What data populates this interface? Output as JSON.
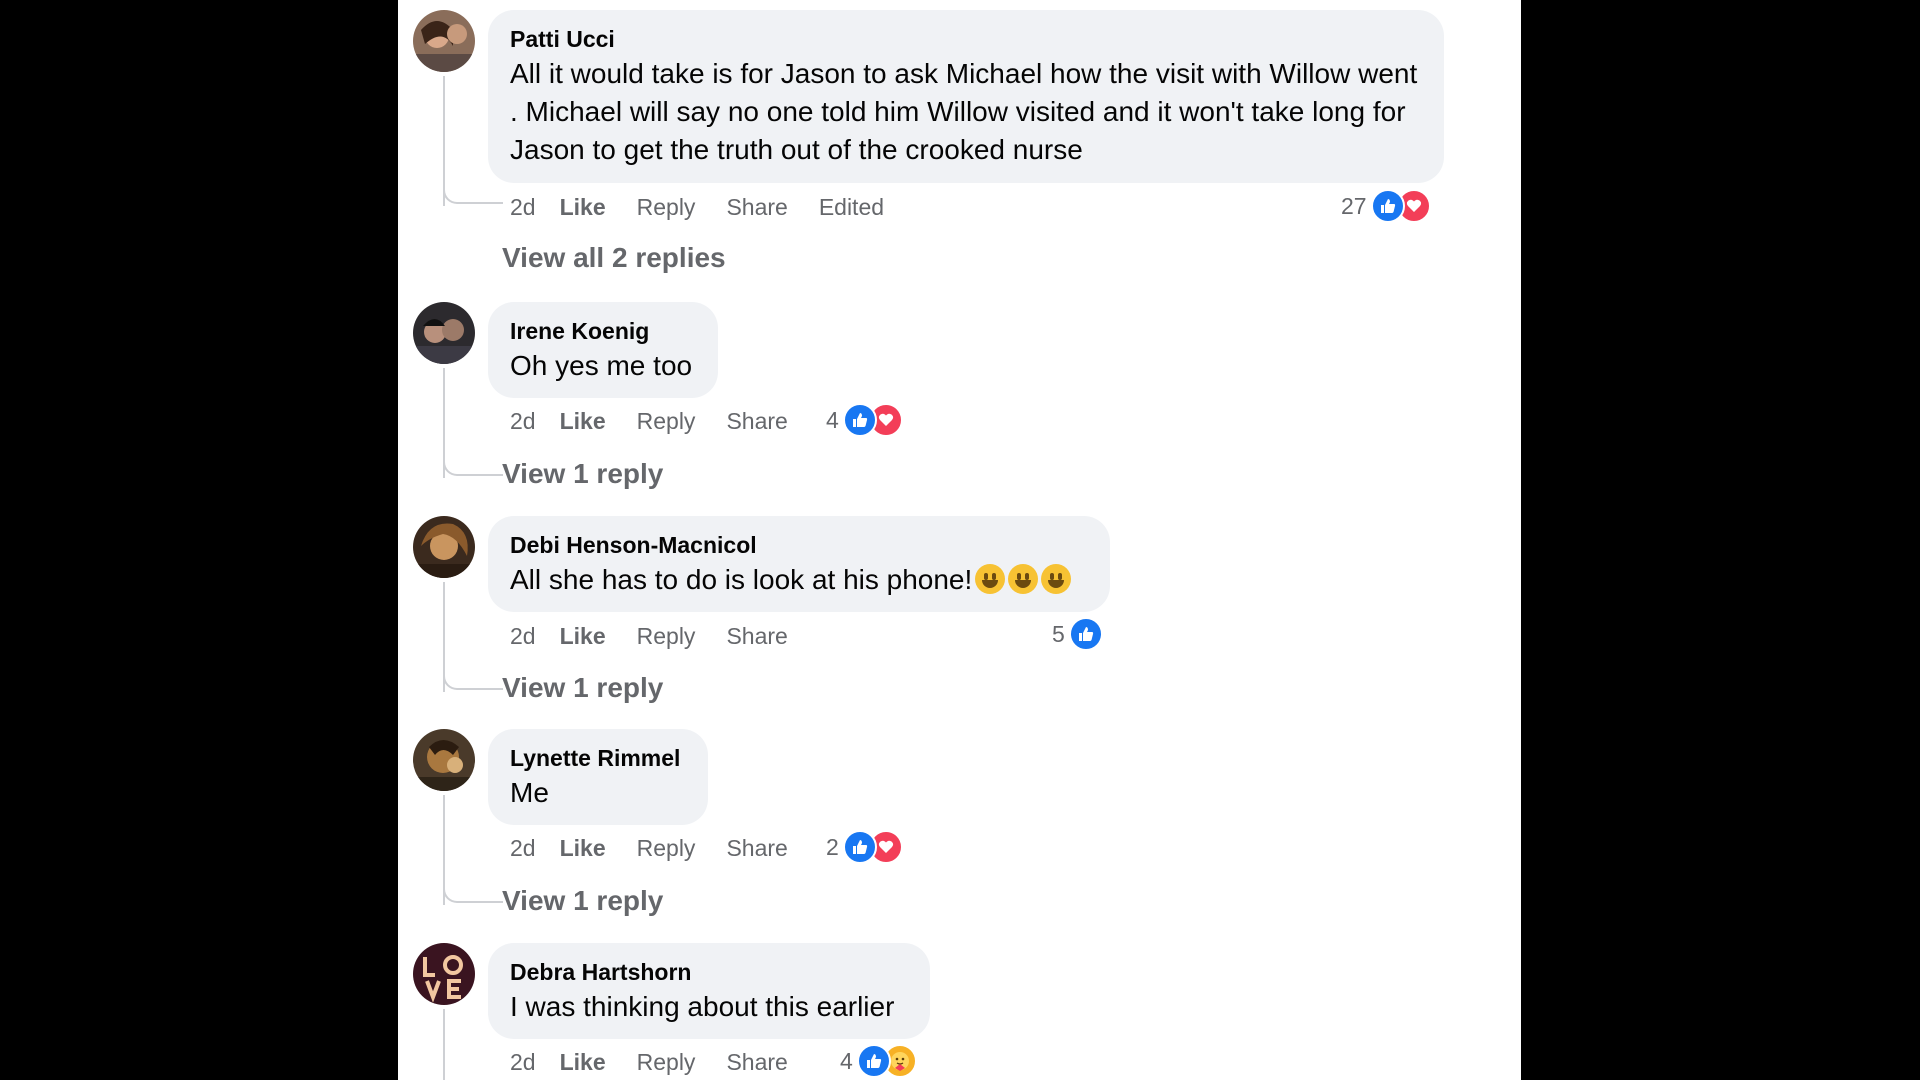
{
  "comments": [
    {
      "author": "Patti Ucci",
      "text": "All it would take is for Jason to ask Michael how the visit with Willow went . Michael will say no one told him Willow visited and it won't take long for Jason to get the truth out of the crooked nurse",
      "time": "2d",
      "like": "Like",
      "reply": "Reply",
      "share": "Share",
      "edited": "Edited",
      "reaction_count": "27",
      "reactions": [
        "like-icon",
        "love-icon"
      ],
      "view_replies": "View all 2 replies"
    },
    {
      "author": "Irene Koenig",
      "text": "Oh yes me too",
      "time": "2d",
      "like": "Like",
      "reply": "Reply",
      "share": "Share",
      "reaction_count": "4",
      "reactions": [
        "like-icon",
        "love-icon"
      ],
      "view_replies": "View 1 reply"
    },
    {
      "author": "Debi Henson-Macnicol",
      "text": "All she has to do is look at his phone!",
      "emojis": [
        "grinning-face-icon",
        "grinning-face-icon",
        "grinning-face-icon"
      ],
      "time": "2d",
      "like": "Like",
      "reply": "Reply",
      "share": "Share",
      "reaction_count": "5",
      "reactions": [
        "like-icon"
      ],
      "view_replies": "View 1 reply"
    },
    {
      "author": "Lynette Rimmel",
      "text": "Me",
      "time": "2d",
      "like": "Like",
      "reply": "Reply",
      "share": "Share",
      "reaction_count": "2",
      "reactions": [
        "like-icon",
        "love-icon"
      ],
      "view_replies": "View 1 reply"
    },
    {
      "author": "Debra Hartshorn",
      "text": "I was thinking about this earlier",
      "time": "2d",
      "like": "Like",
      "reply": "Reply",
      "share": "Share",
      "reaction_count": "4",
      "reactions": [
        "like-icon",
        "care-icon"
      ]
    }
  ],
  "colors": {
    "like_blue": "#1877f2",
    "love_red": "#f33e58",
    "care_yellow": "#f7b125",
    "bubble_bg": "#f0f2f5",
    "secondary_text": "#65676b"
  }
}
